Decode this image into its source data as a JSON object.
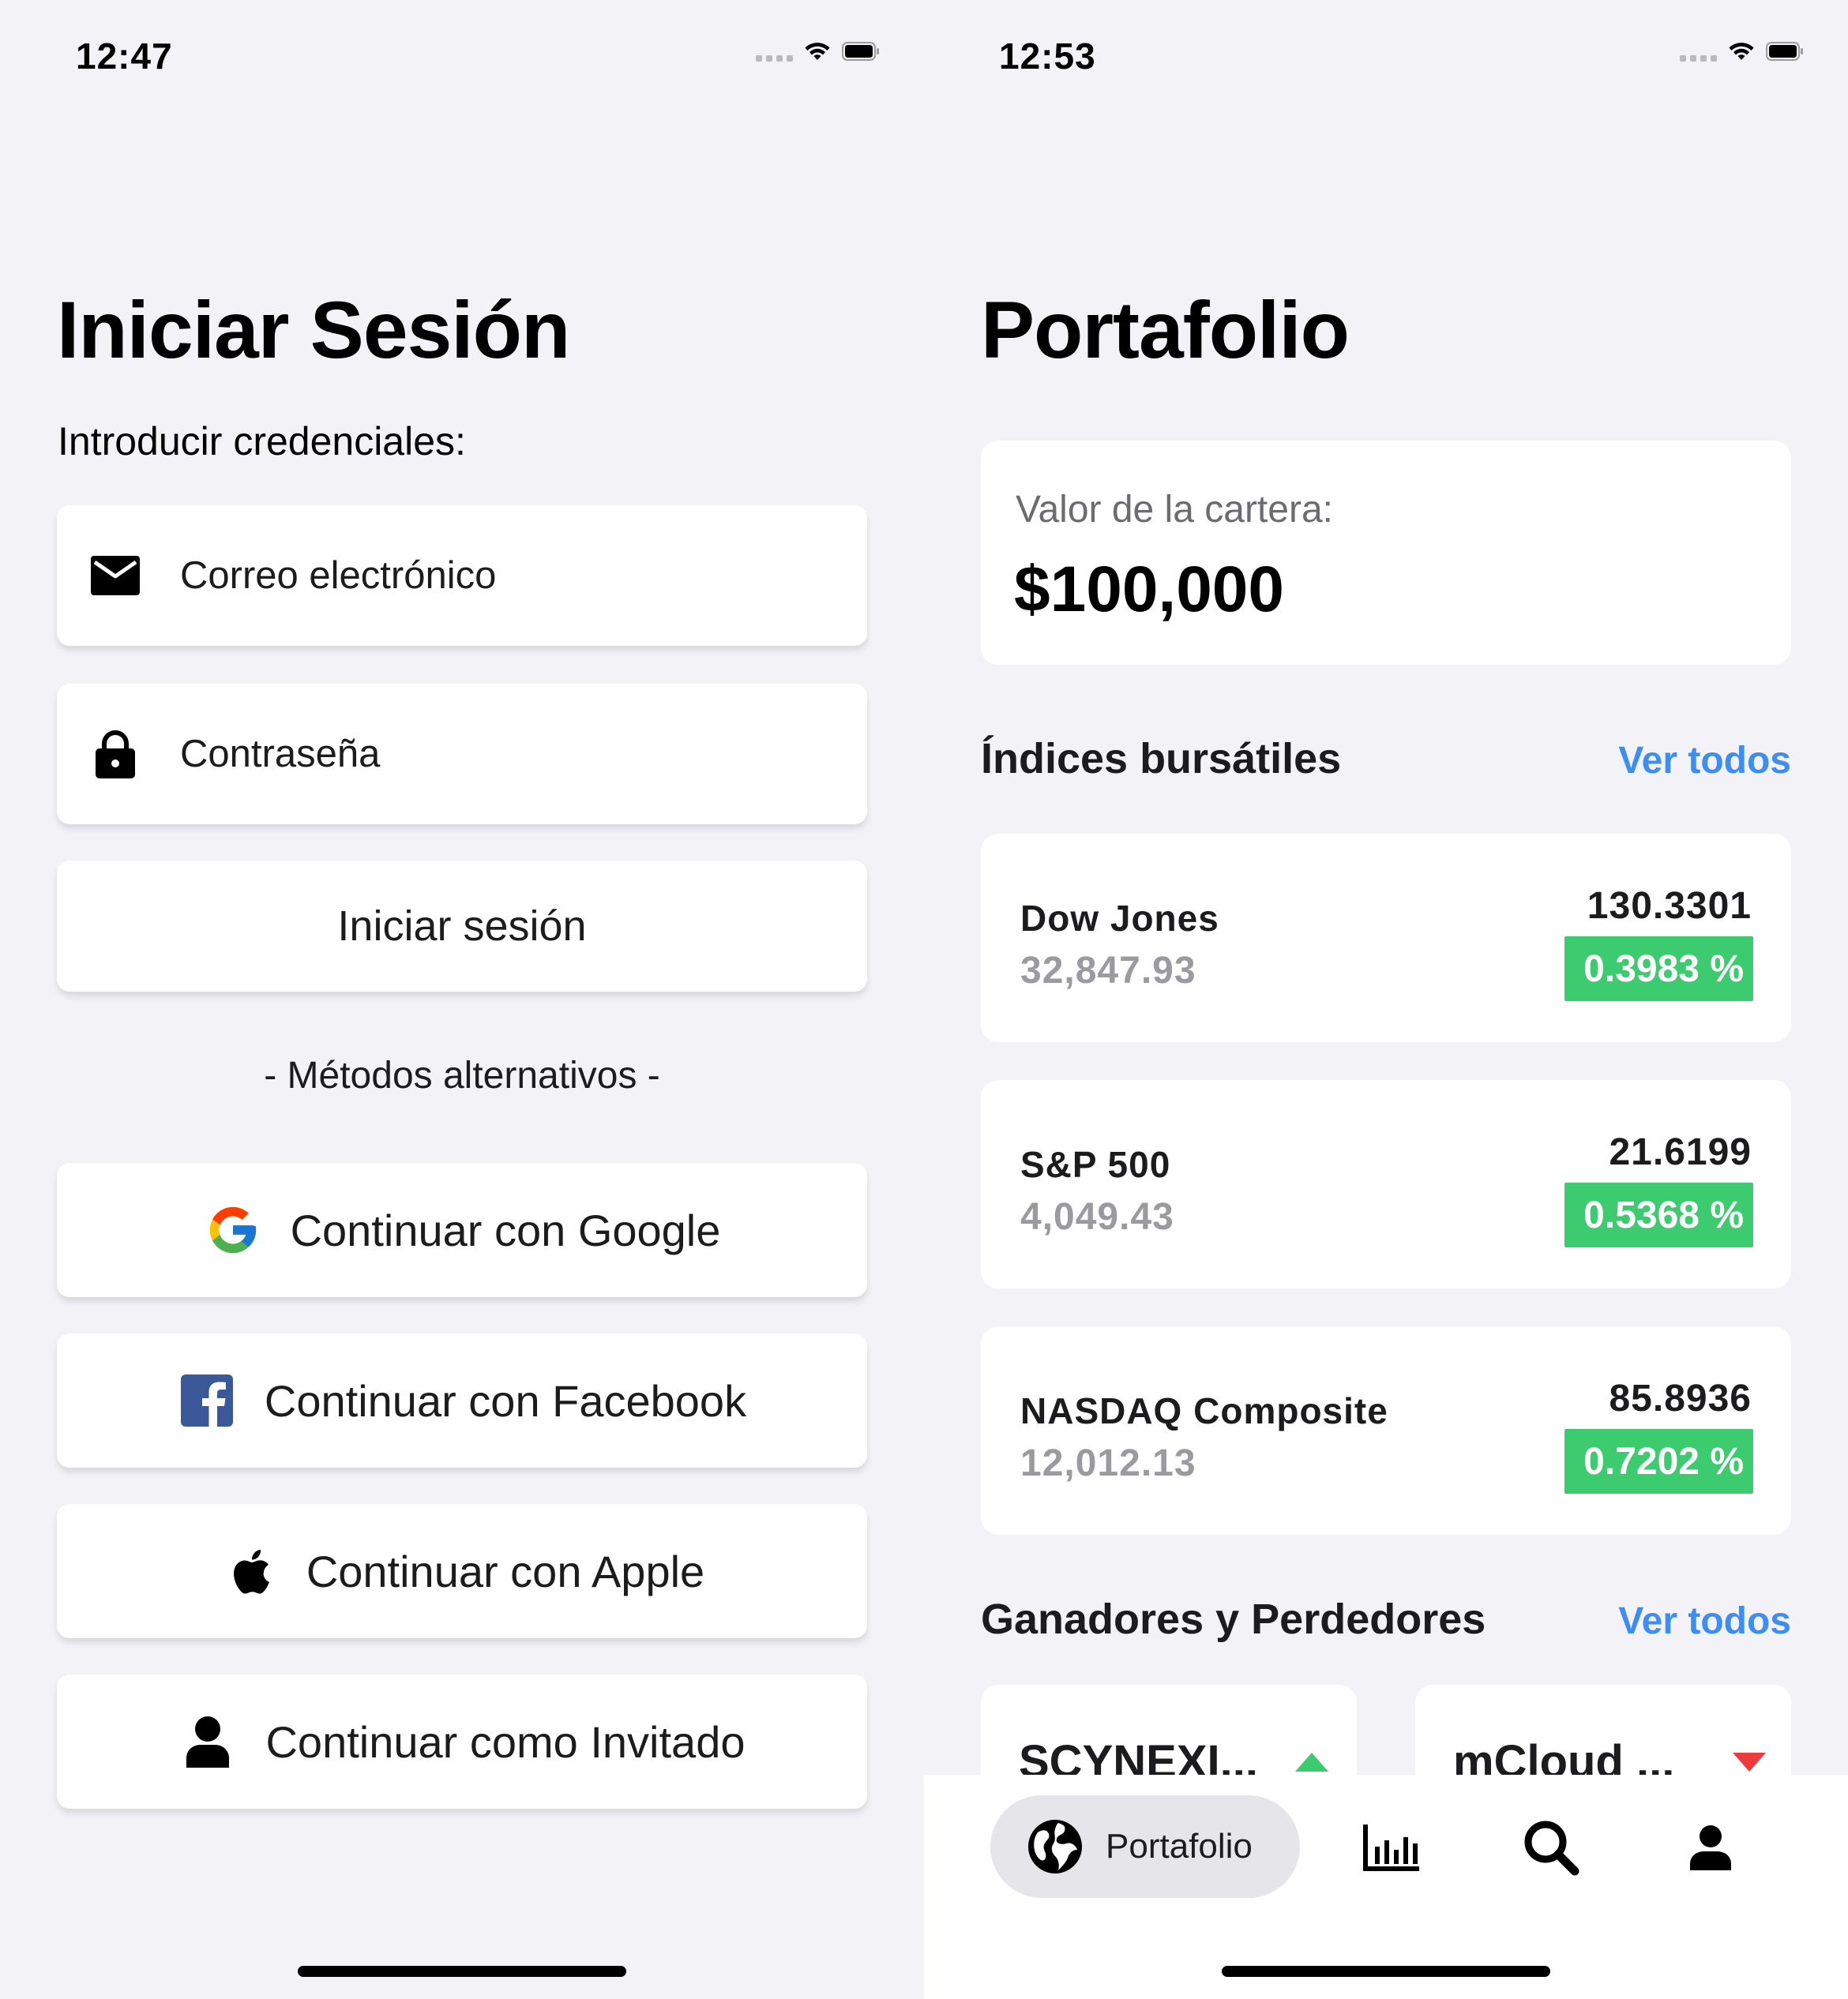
{
  "left": {
    "status_time": "12:47",
    "title": "Iniciar Sesión",
    "subtitle": "Introducir credenciales:",
    "email": {
      "placeholder": "Correo electrónico",
      "icon": "envelope-icon"
    },
    "password": {
      "placeholder": "Contraseña",
      "icon": "lock-icon"
    },
    "login_label": "Iniciar sesión",
    "alt_methods_label": "- Métodos alternativos -",
    "alt_buttons": [
      {
        "label": "Continuar con Google",
        "icon": "google-icon"
      },
      {
        "label": "Continuar con Facebook",
        "icon": "facebook-icon"
      },
      {
        "label": "Continuar con Apple",
        "icon": "apple-icon"
      },
      {
        "label": "Continuar como Invitado",
        "icon": "user-icon"
      }
    ]
  },
  "right": {
    "status_time": "12:53",
    "title": "Portafolio",
    "portfolio_value_label": "Valor de la cartera:",
    "portfolio_value": "$100,000",
    "indices_title": "Índices bursátiles",
    "see_all": "Ver todos",
    "indices": [
      {
        "name": "Dow Jones",
        "value": "32,847.93",
        "change": "130.3301",
        "pct": "0.3983 %"
      },
      {
        "name": "S&P 500",
        "value": "4,049.43",
        "change": "21.6199",
        "pct": "0.5368 %"
      },
      {
        "name": "NASDAQ Composite",
        "value": "12,012.13",
        "change": "85.8936",
        "pct": "0.7202 %"
      }
    ],
    "movers_title": "Ganadores y Perdedores",
    "movers": [
      {
        "name": "SCYNEXI...",
        "direction": "up"
      },
      {
        "name": "mCloud ...",
        "direction": "down"
      }
    ],
    "tabs": [
      {
        "label": "Portafolio",
        "icon": "globe-icon",
        "active": true
      },
      {
        "icon": "bar-chart-icon"
      },
      {
        "icon": "search-icon"
      },
      {
        "icon": "profile-icon"
      }
    ]
  },
  "colors": {
    "background": "#f2f2f7",
    "accent_blue": "#3d8ef2",
    "positive_green": "#3dcb6f",
    "negative_red": "#ee3a3a",
    "muted_gray": "#9a9a9f"
  }
}
